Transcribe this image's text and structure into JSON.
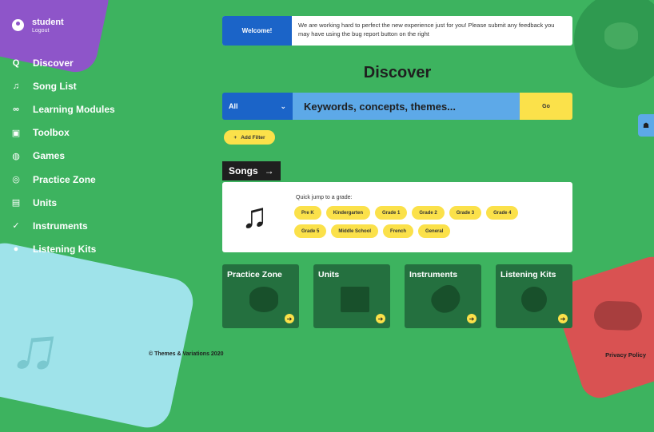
{
  "user": {
    "name": "student",
    "logout_label": "Logout"
  },
  "nav": [
    {
      "label": "Discover",
      "icon": "search-icon",
      "glyph": "Q"
    },
    {
      "label": "Song List",
      "icon": "music-note-icon",
      "glyph": "♫"
    },
    {
      "label": "Learning Modules",
      "icon": "glasses-icon",
      "glyph": "∞"
    },
    {
      "label": "Toolbox",
      "icon": "toolbox-icon",
      "glyph": "▣"
    },
    {
      "label": "Games",
      "icon": "gamepad-icon",
      "glyph": "◍"
    },
    {
      "label": "Practice Zone",
      "icon": "drum-icon",
      "glyph": "◎"
    },
    {
      "label": "Units",
      "icon": "book-icon",
      "glyph": "▤"
    },
    {
      "label": "Instruments",
      "icon": "guitar-icon",
      "glyph": "✓"
    },
    {
      "label": "Listening Kits",
      "icon": "record-icon",
      "glyph": "●"
    }
  ],
  "welcome": {
    "tag": "Welcome!",
    "message": "We are working hard to perfect the new experience just for you! Please submit any feedback you may have using the bug report button on the right"
  },
  "page_title": "Discover",
  "search": {
    "filter_value": "All",
    "placeholder": "Keywords, concepts, themes...",
    "button_label": "Go"
  },
  "add_filter_label": "Add Filter",
  "songs": {
    "button_label": "Songs",
    "quick_jump_label": "Quick jump to a grade:",
    "grades": [
      "Pre K",
      "Kindergarten",
      "Grade 1",
      "Grade 2",
      "Grade 3",
      "Grade 4",
      "Grade 5",
      "Middle School",
      "French",
      "General"
    ]
  },
  "tiles": [
    {
      "title": "Practice Zone",
      "icon": "drum-icon"
    },
    {
      "title": "Units",
      "icon": "book-icon"
    },
    {
      "title": "Instruments",
      "icon": "guitar-icon"
    },
    {
      "title": "Listening Kits",
      "icon": "record-icon"
    }
  ],
  "footer": {
    "copyright": "© Themes & Variations 2020",
    "privacy": "Privacy Policy"
  },
  "colors": {
    "background": "#3db35f",
    "accent_blue": "#1b64c8",
    "accent_yellow": "#fbe14a",
    "tile_green": "#24703f"
  }
}
